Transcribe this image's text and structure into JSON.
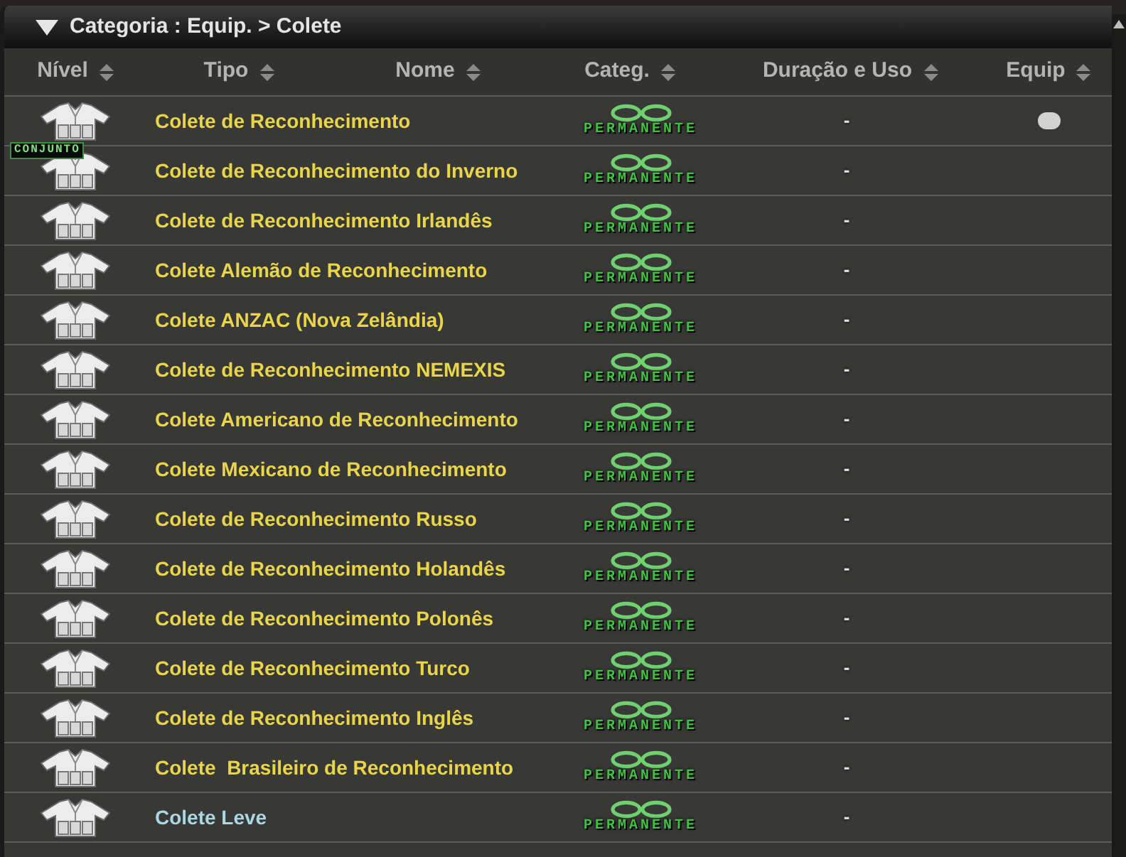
{
  "panel": {
    "title": "Categoria : Equip. > Colete"
  },
  "columns": [
    "Nível",
    "Tipo",
    "Nome",
    "Categ.",
    "Duração e Uso",
    "Equip"
  ],
  "items": [
    {
      "name": "Colete de Reconhecimento",
      "color": "#e9d54a",
      "category": "PERMANENTE",
      "duration": "-",
      "equipped": true
    },
    {
      "name": "Colete de Reconhecimento do Inverno",
      "color": "#e9d54a",
      "category": "PERMANENTE",
      "duration": "-",
      "equipped": false,
      "badge": "CONJUNTO"
    },
    {
      "name": "Colete de Reconhecimento Irlandês",
      "color": "#e9d54a",
      "category": "PERMANENTE",
      "duration": "-",
      "equipped": false
    },
    {
      "name": "Colete Alemão de Reconhecimento",
      "color": "#e9d54a",
      "category": "PERMANENTE",
      "duration": "-",
      "equipped": false
    },
    {
      "name": "Colete ANZAC (Nova Zelândia)",
      "color": "#e9d54a",
      "category": "PERMANENTE",
      "duration": "-",
      "equipped": false
    },
    {
      "name": "Colete de Reconhecimento NEMEXIS",
      "color": "#e9d54a",
      "category": "PERMANENTE",
      "duration": "-",
      "equipped": false
    },
    {
      "name": "Colete Americano de Reconhecimento",
      "color": "#e9d54a",
      "category": "PERMANENTE",
      "duration": "-",
      "equipped": false
    },
    {
      "name": "Colete Mexicano de Reconhecimento",
      "color": "#e9d54a",
      "category": "PERMANENTE",
      "duration": "-",
      "equipped": false
    },
    {
      "name": "Colete de Reconhecimento Russo",
      "color": "#e9d54a",
      "category": "PERMANENTE",
      "duration": "-",
      "equipped": false
    },
    {
      "name": "Colete de Reconhecimento Holandês",
      "color": "#e9d54a",
      "category": "PERMANENTE",
      "duration": "-",
      "equipped": false
    },
    {
      "name": "Colete de Reconhecimento Polonês",
      "color": "#e9d54a",
      "category": "PERMANENTE",
      "duration": "-",
      "equipped": false
    },
    {
      "name": "Colete de Reconhecimento Turco",
      "color": "#e9d54a",
      "category": "PERMANENTE",
      "duration": "-",
      "equipped": false
    },
    {
      "name": "Colete de Reconhecimento Inglês",
      "color": "#e9d54a",
      "category": "PERMANENTE",
      "duration": "-",
      "equipped": false
    },
    {
      "name": "Colete  Brasileiro de Reconhecimento",
      "color": "#e9d54a",
      "category": "PERMANENTE",
      "duration": "-",
      "equipped": false
    },
    {
      "name": "Colete Leve",
      "color": "#a9d8e2",
      "category": "PERMANENTE",
      "duration": "-",
      "equipped": false
    }
  ]
}
